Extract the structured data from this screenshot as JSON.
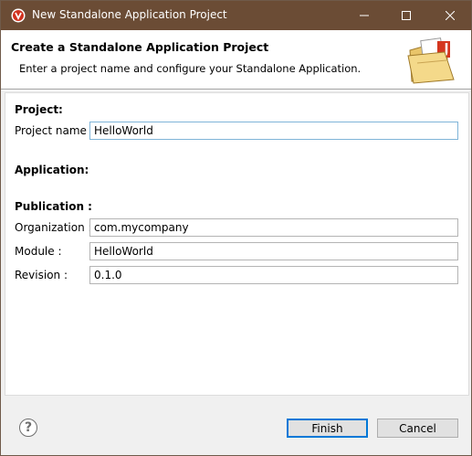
{
  "window": {
    "title": "New Standalone Application Project"
  },
  "banner": {
    "title": "Create a Standalone Application Project",
    "description": "Enter a project name and configure your Standalone Application."
  },
  "form": {
    "project_section": "Project:",
    "project_name_label": "Project name :",
    "project_name_value": "HelloWorld",
    "application_section": "Application:",
    "publication_section": "Publication :",
    "organization_label": "Organization :",
    "organization_value": "com.mycompany",
    "module_label": "Module :",
    "module_value": "HelloWorld",
    "revision_label": "Revision :",
    "revision_value": "0.1.0"
  },
  "buttons": {
    "help_glyph": "?",
    "finish": "Finish",
    "cancel": "Cancel"
  },
  "colors": {
    "titlebar": "#6b4c35",
    "focus_border": "#7fb4d8",
    "default_button_border": "#0078d7"
  },
  "icons": {
    "app": "ivy-app-icon",
    "banner": "folder-java-icon",
    "help": "help-icon"
  }
}
